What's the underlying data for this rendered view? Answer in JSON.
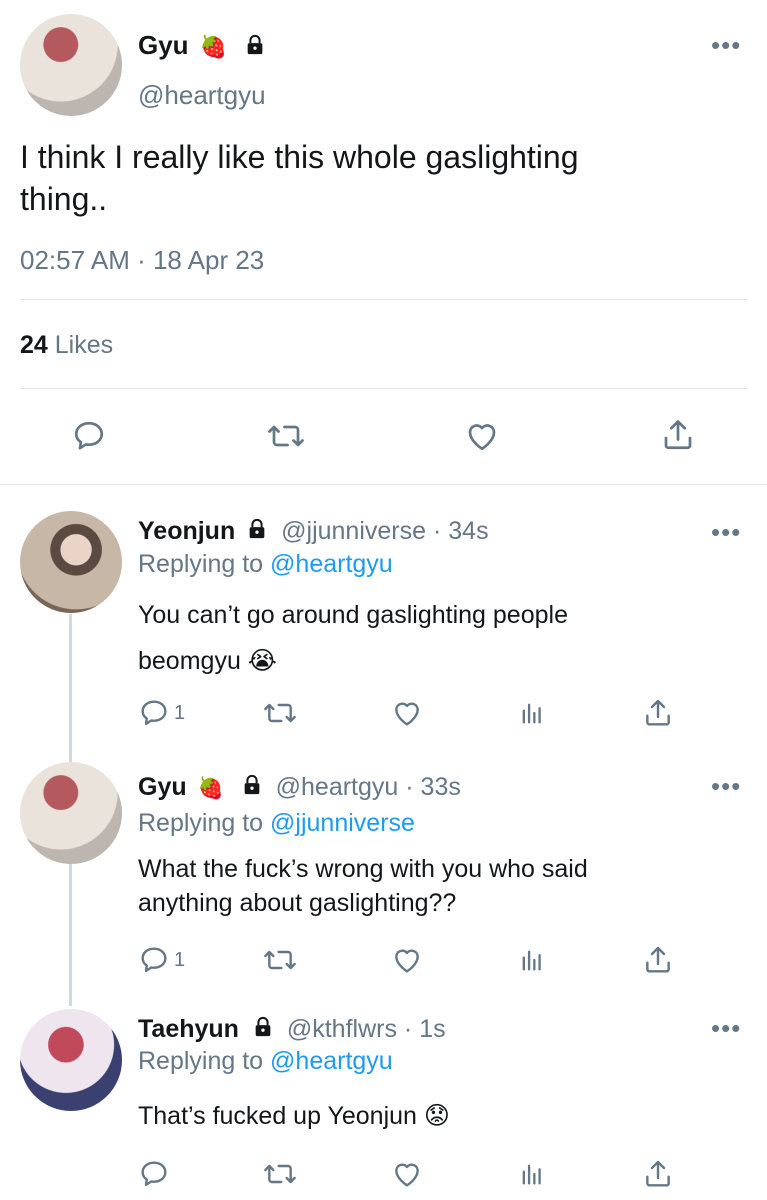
{
  "main_tweet": {
    "display_name": "Gyu",
    "handle": "@heartgyu",
    "text_line1": "I think I really like this whole gaslighting",
    "text_line2": "thing..",
    "timestamp": "02:57 AM · 18 Apr 23",
    "likes_count": "24",
    "likes_label": "Likes",
    "strawberry_emoji": "🍓"
  },
  "replies": [
    {
      "display_name": "Yeonjun",
      "handle": "@jjunniverse",
      "time": "· 34s",
      "replying_label": "Replying to",
      "replying_to": "@heartgyu",
      "text_line1": "You can’t go around gaslighting people",
      "text_line2": "beomgyu 😭",
      "reply_count": "1"
    },
    {
      "display_name": "Gyu",
      "strawberry_emoji": "🍓",
      "handle": "@heartgyu",
      "time": "· 33s",
      "replying_label": "Replying to",
      "replying_to": "@jjunniverse",
      "text_line1": "What the fuck’s wrong with you who said",
      "text_line2": "anything about gaslighting??",
      "reply_count": "1"
    },
    {
      "display_name": "Taehyun",
      "handle": "@kthflwrs",
      "time": "· 1s",
      "replying_label": "Replying to",
      "replying_to": "@heartgyu",
      "text_line1": "That’s fucked up Yeonjun 😟",
      "reply_count": ""
    }
  ],
  "icons": {
    "more": "more-icon",
    "lock": "lock-icon",
    "reply": "reply-icon",
    "retweet": "retweet-icon",
    "like": "like-icon",
    "share": "share-icon",
    "analytics": "analytics-icon"
  },
  "colors": {
    "accent": "#1d9bf0",
    "muted": "#657786",
    "text": "#14171a"
  }
}
